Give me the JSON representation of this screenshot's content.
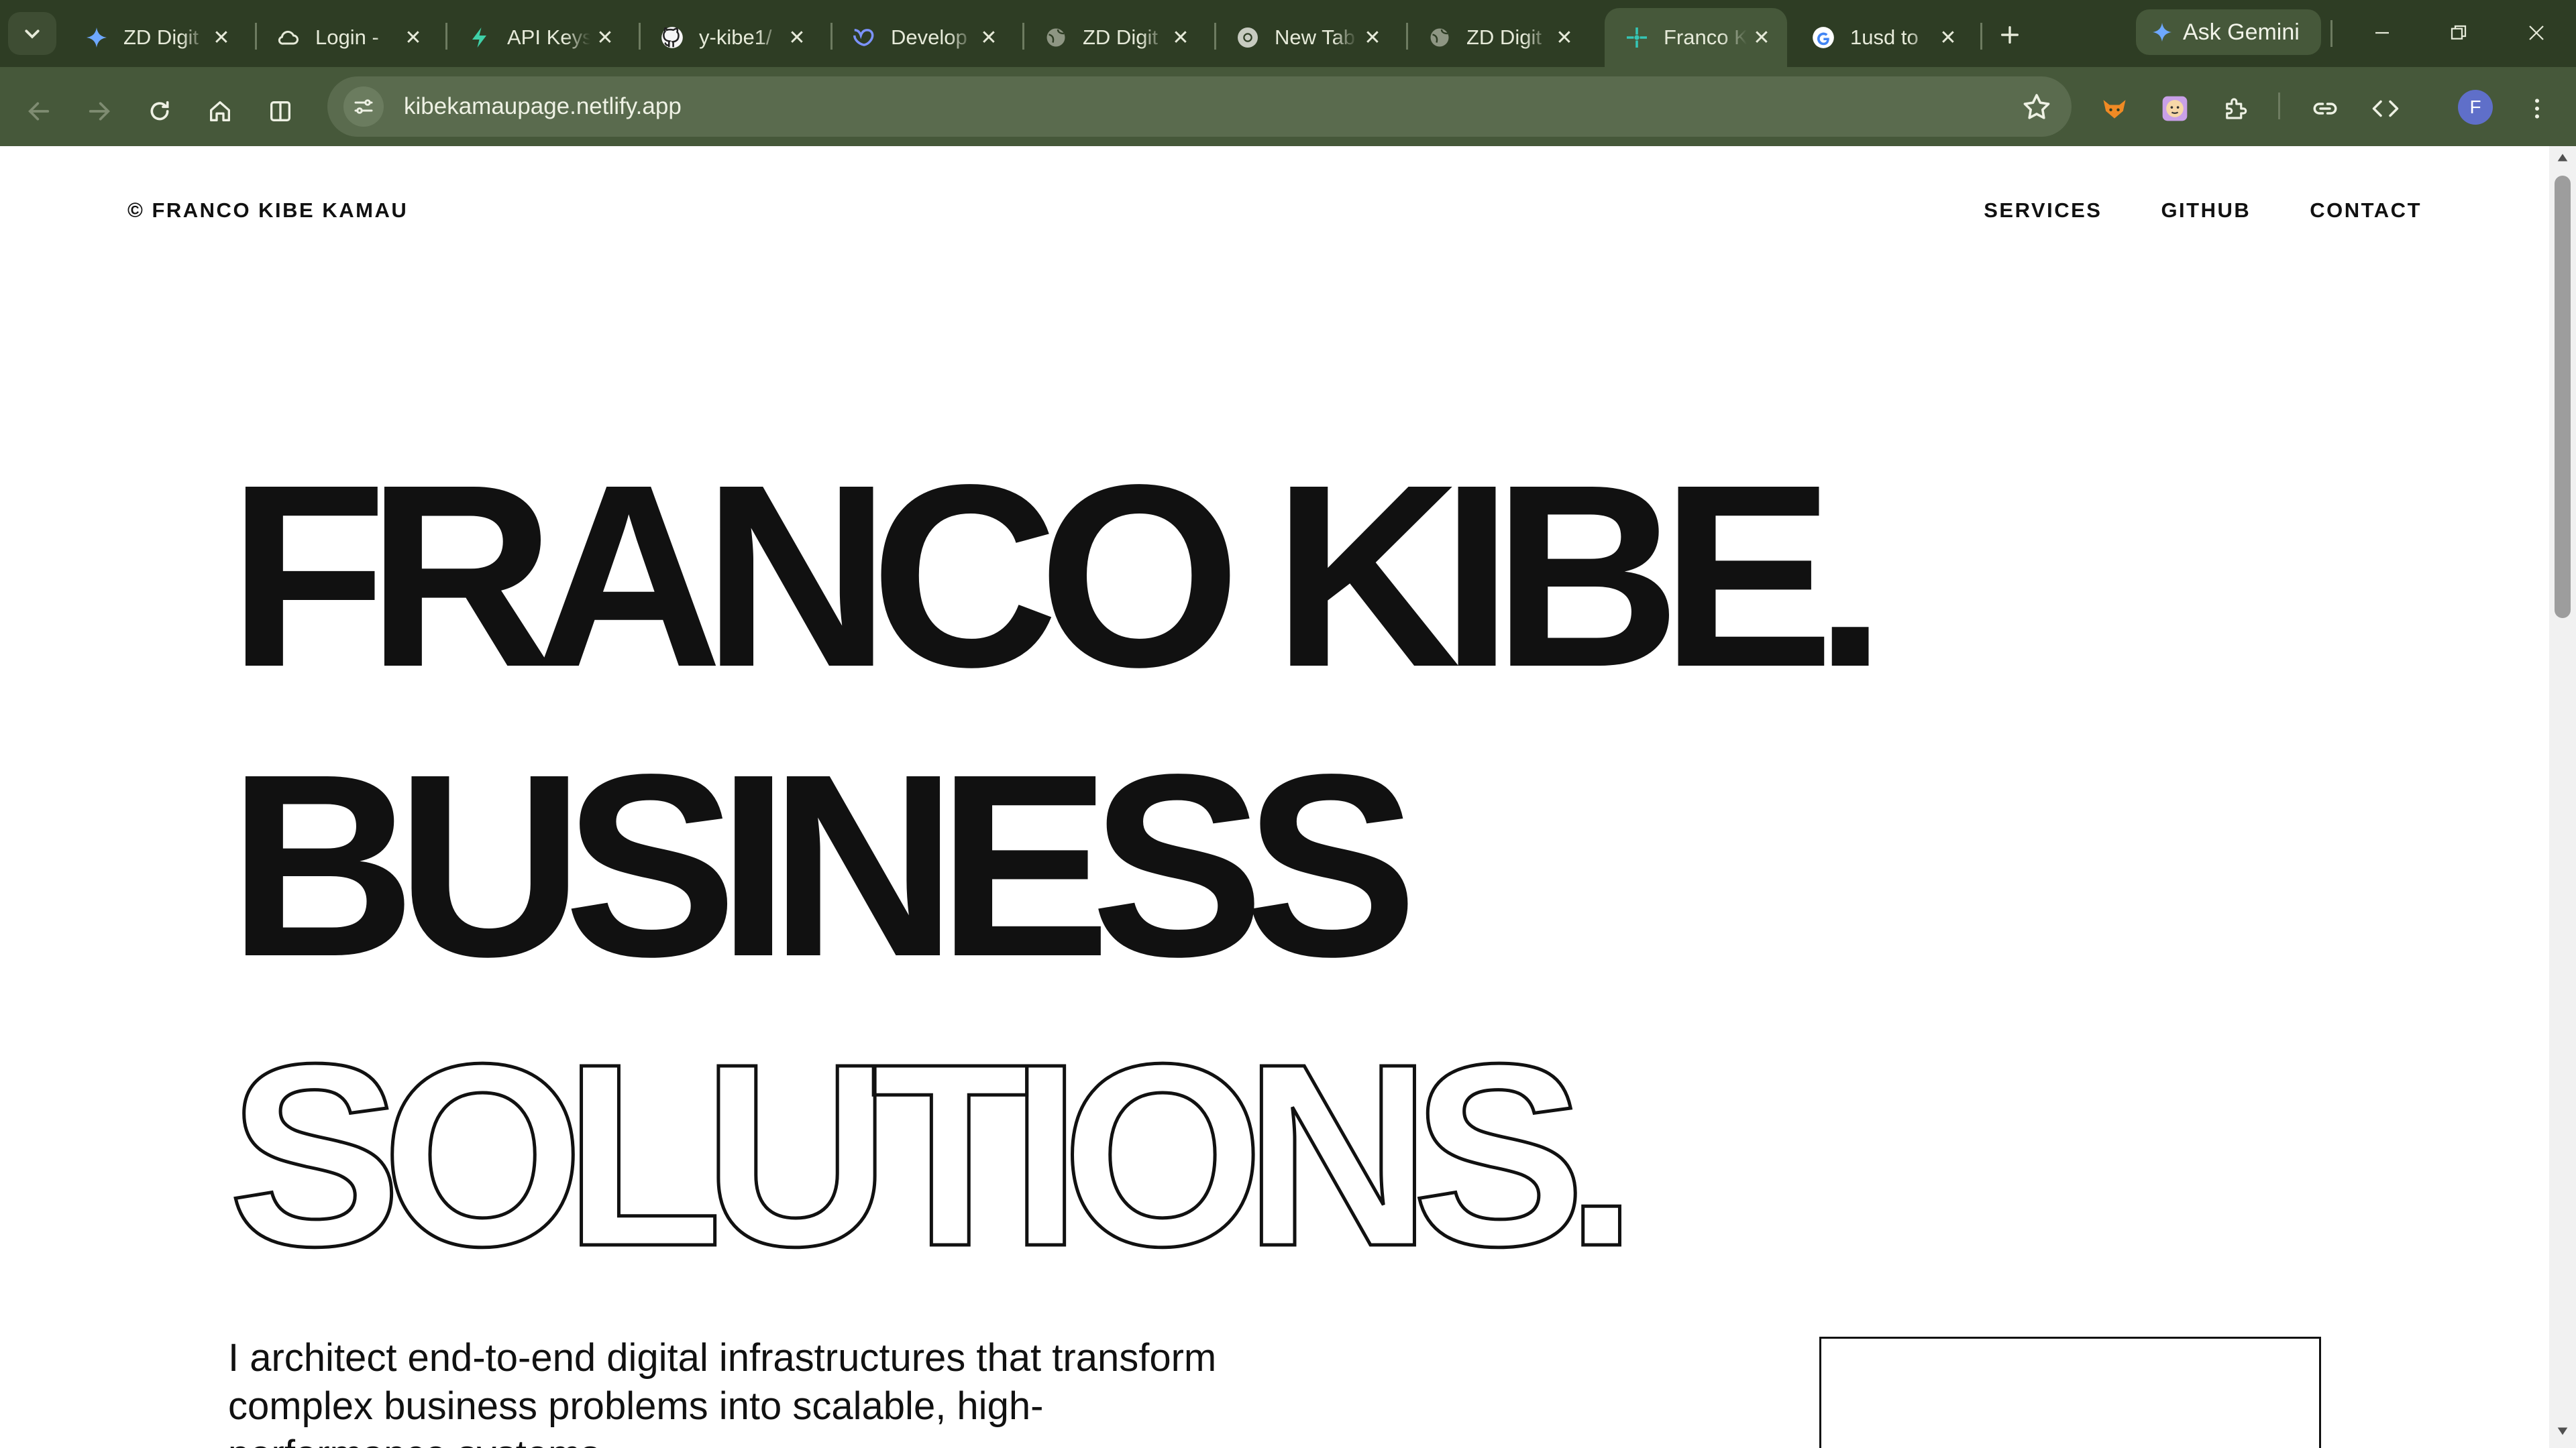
{
  "browser": {
    "tabs": [
      {
        "title": "ZD Digit",
        "icon": "gemini-sparkle-icon"
      },
      {
        "title": "Login - ",
        "icon": "cloud-icon"
      },
      {
        "title": "API Keys",
        "icon": "bolt-icon"
      },
      {
        "title": "y-kibe1/",
        "icon": "github-icon"
      },
      {
        "title": "Develop",
        "icon": "developer-logo-icon"
      },
      {
        "title": "ZD Digit",
        "icon": "globe-icon"
      },
      {
        "title": "New Tab",
        "icon": "chrome-icon"
      },
      {
        "title": "ZD Digit",
        "icon": "globe-icon"
      },
      {
        "title": "Franco K",
        "icon": "netlify-icon",
        "active": true
      },
      {
        "title": "1usd to",
        "icon": "google-icon"
      }
    ],
    "ask_gemini_label": "Ask Gemini",
    "url": "kibekamaupage.netlify.app",
    "profile_initial": "F"
  },
  "site": {
    "brand": "© FRANCO KIBE KAMAU",
    "nav": [
      "SERVICES",
      "GITHUB",
      "CONTACT"
    ],
    "hero": {
      "line1": "FRANCO KIBE.",
      "line2": "BUSINESS",
      "line3": "SOLUTIONS."
    },
    "lead": "I architect end-to-end digital infrastructures that transform complex business problems into scalable, high-performance systems."
  },
  "colors": {
    "chrome_dark": "#2e3d24",
    "chrome_toolbar": "#46583a",
    "omnibox": "#5a6b4e",
    "ink": "#111111",
    "page_bg": "#ffffff"
  }
}
